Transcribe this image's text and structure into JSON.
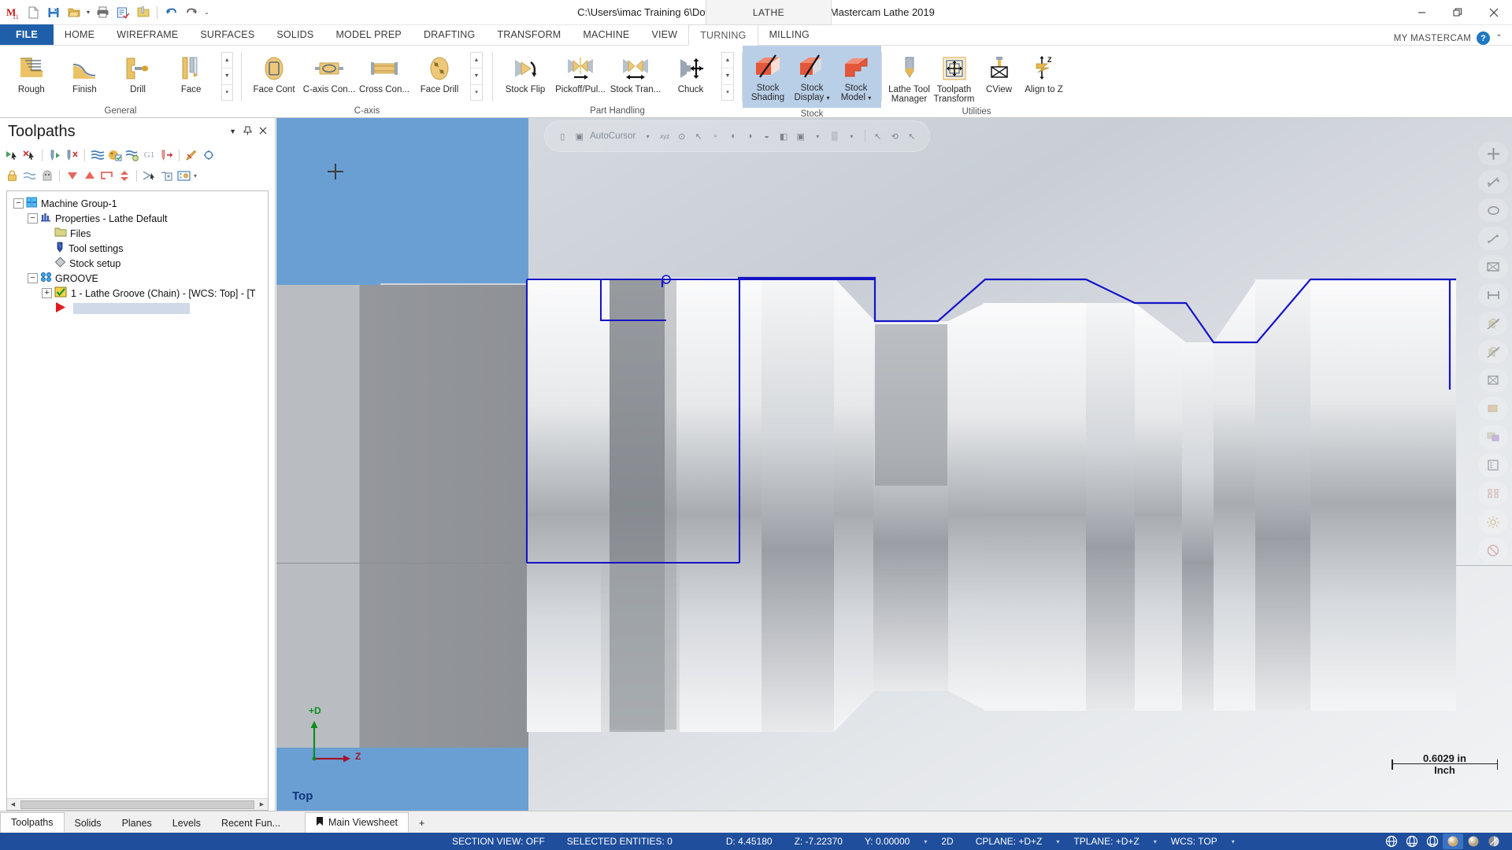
{
  "titlebar": {
    "document_title": "C:\\Users\\imac Training 6\\Downloads\\6812B-21.mcam - Mastercam Lathe 2019",
    "lathe_tab": "LATHE",
    "quick_access": [
      {
        "name": "mastercam-logo-icon",
        "glyph": "M"
      },
      {
        "name": "new-file-icon",
        "glyph": "⬜"
      },
      {
        "name": "save-icon",
        "glyph": "💾"
      },
      {
        "name": "open-file-icon",
        "glyph": "📂"
      },
      {
        "name": "print-icon",
        "glyph": "🖨"
      },
      {
        "name": "save-as-icon",
        "glyph": "📝"
      },
      {
        "name": "zip-file-icon",
        "glyph": "🗂"
      },
      {
        "name": "undo-icon",
        "glyph": "↶"
      },
      {
        "name": "redo-icon",
        "glyph": "↷"
      },
      {
        "name": "customize-qat-icon",
        "glyph": "≡"
      }
    ],
    "window_buttons": [
      {
        "name": "minimize-button",
        "glyph": "—"
      },
      {
        "name": "maximize-button",
        "glyph": "❐"
      },
      {
        "name": "close-button",
        "glyph": "✕"
      }
    ]
  },
  "ribbon": {
    "tabs": [
      {
        "label": "FILE",
        "id": "file",
        "state": "file"
      },
      {
        "label": "HOME",
        "id": "home",
        "state": "normal"
      },
      {
        "label": "WIREFRAME",
        "id": "wireframe",
        "state": "normal"
      },
      {
        "label": "SURFACES",
        "id": "surfaces",
        "state": "normal"
      },
      {
        "label": "SOLIDS",
        "id": "solids",
        "state": "normal"
      },
      {
        "label": "MODEL PREP",
        "id": "model-prep",
        "state": "normal"
      },
      {
        "label": "DRAFTING",
        "id": "drafting",
        "state": "normal"
      },
      {
        "label": "TRANSFORM",
        "id": "transform",
        "state": "normal"
      },
      {
        "label": "MACHINE",
        "id": "machine",
        "state": "normal"
      },
      {
        "label": "VIEW",
        "id": "view",
        "state": "normal"
      },
      {
        "label": "TURNING",
        "id": "turning",
        "state": "active"
      },
      {
        "label": "MILLING",
        "id": "milling",
        "state": "normal"
      }
    ],
    "my_mastercam": "MY MASTERCAM",
    "groups": [
      {
        "name": "General",
        "label": "General",
        "buttons": [
          {
            "label": "Rough",
            "icon": "rough-toolpath-icon"
          },
          {
            "label": "Finish",
            "icon": "finish-toolpath-icon"
          },
          {
            "label": "Drill",
            "icon": "drill-toolpath-icon"
          },
          {
            "label": "Face",
            "icon": "face-toolpath-icon"
          }
        ],
        "has_gallery_scroll": true
      },
      {
        "name": "C-axis",
        "label": "C-axis",
        "buttons": [
          {
            "label": "Face Cont",
            "icon": "face-contour-icon"
          },
          {
            "label": "C-axis Con...",
            "icon": "c-axis-contour-icon"
          },
          {
            "label": "Cross Con...",
            "icon": "cross-contour-icon"
          },
          {
            "label": "Face Drill",
            "icon": "face-drill-icon"
          }
        ],
        "has_gallery_scroll": true
      },
      {
        "name": "Part Handling",
        "label": "Part Handling",
        "buttons": [
          {
            "label": "Stock Flip",
            "icon": "stock-flip-icon"
          },
          {
            "label": "Pickoff/Pul...",
            "icon": "pickoff-pull-icon"
          },
          {
            "label": "Stock Tran...",
            "icon": "stock-transfer-icon"
          },
          {
            "label": "Chuck",
            "icon": "chuck-icon"
          }
        ],
        "has_gallery_scroll": true
      },
      {
        "name": "Stock",
        "label": "Stock",
        "buttons": [
          {
            "label": "Stock Shading",
            "icon": "stock-shading-icon",
            "selected": true
          },
          {
            "label": "Stock Display",
            "icon": "stock-display-icon",
            "selected": true,
            "dropdown": true
          },
          {
            "label": "Stock Model",
            "icon": "stock-model-icon",
            "dropdown": true
          }
        ],
        "has_gallery_scroll": false
      },
      {
        "name": "Utilities",
        "label": "Utilities",
        "buttons": [
          {
            "label": "Lathe Tool Manager",
            "icon": "lathe-tool-manager-icon"
          },
          {
            "label": "Toolpath Transform",
            "icon": "toolpath-transform-icon"
          },
          {
            "label": "CView",
            "icon": "cview-icon"
          },
          {
            "label": "Align to Z",
            "icon": "align-to-z-icon"
          }
        ],
        "has_gallery_scroll": false
      }
    ]
  },
  "toolpaths_panel": {
    "title": "Toolpaths",
    "header_icons": [
      {
        "name": "panel-dropdown-icon",
        "glyph": "▾"
      },
      {
        "name": "panel-pin-icon",
        "glyph": "⚑"
      },
      {
        "name": "panel-close-icon",
        "glyph": "✕"
      }
    ],
    "toolbar_row1": [
      {
        "name": "select-all-toolpaths-icon",
        "glyph": "▶"
      },
      {
        "name": "deselect-all-toolpaths-icon",
        "glyph": "✕"
      },
      {
        "name": "regenerate-selected-icon",
        "glyph": "↑"
      },
      {
        "name": "regenerate-invalid-icon",
        "glyph": "✗"
      },
      {
        "name": "simulate-toolpath-icon",
        "glyph": "≈"
      },
      {
        "name": "verify-toolpath-icon",
        "glyph": "▦"
      },
      {
        "name": "backplot-icon",
        "glyph": "≋"
      },
      {
        "name": "g1-post-icon",
        "glyph": "G1"
      },
      {
        "name": "high-speed-icon",
        "glyph": "↳"
      },
      {
        "name": "edit-toolpath-icon",
        "glyph": "✎"
      }
    ],
    "toolbar_row2": [
      {
        "name": "lock-toolpath-icon",
        "glyph": "🔒"
      },
      {
        "name": "toggle-posting-icon",
        "glyph": "≈"
      },
      {
        "name": "toggle-display-icon",
        "glyph": "●"
      },
      {
        "name": "move-down-icon",
        "glyph": "▼"
      },
      {
        "name": "move-up-icon",
        "glyph": "▲"
      },
      {
        "name": "new-group-icon",
        "glyph": "⌐"
      },
      {
        "name": "expand-collapse-icon",
        "glyph": "↕"
      },
      {
        "name": "toolpath-filter-icon",
        "glyph": "✂"
      },
      {
        "name": "copy-toolpath-icon",
        "glyph": "❐"
      },
      {
        "name": "toolpath-options-icon",
        "glyph": "☷"
      },
      {
        "name": "options-dropdown-icon",
        "glyph": "▾"
      }
    ],
    "tree": [
      {
        "indent": 0,
        "expander": "-",
        "icon": "machine-group-icon",
        "label": "Machine Group-1",
        "selected": false
      },
      {
        "indent": 1,
        "expander": "-",
        "icon": "properties-icon",
        "label": "Properties - Lathe Default",
        "selected": false
      },
      {
        "indent": 2,
        "expander": "",
        "icon": "files-folder-icon",
        "label": "Files",
        "selected": false
      },
      {
        "indent": 2,
        "expander": "",
        "icon": "tool-settings-icon",
        "label": "Tool settings",
        "selected": false
      },
      {
        "indent": 2,
        "expander": "",
        "icon": "stock-setup-icon",
        "label": "Stock setup",
        "selected": false
      },
      {
        "indent": 1,
        "expander": "-",
        "icon": "toolpath-group-icon",
        "label": "GROOVE",
        "selected": false
      },
      {
        "indent": 2,
        "expander": "+",
        "icon": "lathe-groove-op-icon",
        "label": "1 - Lathe Groove (Chain) - [WCS: Top] - [T",
        "selected": false
      },
      {
        "indent": 3,
        "expander": "",
        "icon": "insert-arrow-icon",
        "label": "",
        "selected": true
      }
    ]
  },
  "viewport": {
    "autocursor": {
      "label": "AutoCursor",
      "icons": [
        {
          "name": "autocursor-snap-icon",
          "glyph": "▣"
        },
        {
          "name": "autocursor-pointer-icon",
          "glyph": "↖"
        },
        {
          "name": "autocursor-dropdown-icon",
          "glyph": "▾"
        },
        {
          "name": "xyz-coordinate-icon",
          "glyph": "xyz"
        },
        {
          "name": "origin-snap-icon",
          "glyph": "⊙"
        },
        {
          "name": "arrow-select-icon",
          "glyph": "↖"
        },
        {
          "name": "midpoint-snap-icon",
          "glyph": "▫"
        },
        {
          "name": "endpoint-snap-icon",
          "glyph": "◖"
        },
        {
          "name": "center-snap-icon",
          "glyph": "◑"
        },
        {
          "name": "quadrant-snap-icon",
          "glyph": "◒"
        },
        {
          "name": "intersection-snap-icon",
          "glyph": "◧"
        },
        {
          "name": "nearest-snap-icon",
          "glyph": "▣"
        },
        {
          "name": "snap-dropdown-icon",
          "glyph": "▾"
        },
        {
          "name": "grid-snap-icon",
          "glyph": "▒"
        },
        {
          "name": "grid-dropdown-icon",
          "glyph": "▾"
        },
        {
          "name": "undo-selection-icon",
          "glyph": "↶"
        },
        {
          "name": "select-chain-icon",
          "glyph": "↖"
        },
        {
          "name": "rotate-view-icon",
          "glyph": "⟲"
        },
        {
          "name": "pick-entity-icon",
          "glyph": "↖"
        }
      ]
    },
    "gnomon": {
      "d_axis": "+D",
      "z_axis": "Z",
      "d_color": "#0a8f1e",
      "z_color": "#a3142b"
    },
    "view_name": "Top",
    "scale": {
      "value": "0.6029 in",
      "unit": "Inch"
    },
    "right_toolbar": [
      {
        "name": "fit-to-screen-icon",
        "glyph": "✚"
      },
      {
        "name": "zoom-window-icon",
        "glyph": "↗"
      },
      {
        "name": "zoom-circle-icon",
        "glyph": "◯"
      },
      {
        "name": "spline-view-icon",
        "glyph": "∿"
      },
      {
        "name": "isometric-view-icon",
        "glyph": "⬡"
      },
      {
        "name": "dimension-view-icon",
        "glyph": "⇔"
      },
      {
        "name": "wireframe-shade-icon",
        "glyph": "◫"
      },
      {
        "name": "translucent-shade-icon",
        "glyph": "◩"
      },
      {
        "name": "solid-box-icon",
        "glyph": "⬚"
      },
      {
        "name": "stock-visibility-icon",
        "glyph": "■"
      },
      {
        "name": "levels-icon",
        "glyph": "◰"
      },
      {
        "name": "list-view-icon",
        "glyph": "☰"
      },
      {
        "name": "analyze-icon",
        "glyph": "⌗"
      },
      {
        "name": "settings-gear-icon",
        "glyph": "⚙"
      },
      {
        "name": "blank-entity-icon",
        "glyph": "⊘"
      }
    ]
  },
  "bottom_tabs": {
    "panel_tabs": [
      {
        "label": "Toolpaths",
        "active": true
      },
      {
        "label": "Solids",
        "active": false
      },
      {
        "label": "Planes",
        "active": false
      },
      {
        "label": "Levels",
        "active": false
      },
      {
        "label": "Recent Fun...",
        "active": false
      }
    ],
    "viewsheets": [
      {
        "label": "Main Viewsheet",
        "active": true,
        "icon": "bookmark-icon"
      }
    ],
    "add_viewsheet": "+"
  },
  "statusbar": {
    "items": [
      {
        "label": "SECTION VIEW: OFF",
        "name": "section-view-status"
      },
      {
        "label": "SELECTED ENTITIES: 0",
        "name": "selected-entities-status"
      },
      {
        "label": "D:   4.45180",
        "name": "d-coordinate"
      },
      {
        "label": "Z:   -7.22370",
        "name": "z-coordinate"
      },
      {
        "label": "Y:   0.00000",
        "name": "y-coordinate"
      },
      {
        "label": "2D",
        "name": "dimension-mode",
        "caret": true
      },
      {
        "label": "CPLANE: +D+Z",
        "name": "cplane-selector",
        "caret": true
      },
      {
        "label": "TPLANE: +D+Z",
        "name": "tplane-selector",
        "caret": true
      },
      {
        "label": "WCS: TOP",
        "name": "wcs-selector",
        "caret": true
      }
    ],
    "graphics_icons": [
      {
        "name": "wireframe-display-icon",
        "glyph": "⊕",
        "active": false
      },
      {
        "name": "hidden-line-display-icon",
        "glyph": "⊖",
        "active": false
      },
      {
        "name": "shaded-wireframe-icon",
        "glyph": "⊗",
        "active": false
      },
      {
        "name": "gouraud-shaded-icon",
        "glyph": "◕",
        "active": true
      },
      {
        "name": "flat-shaded-icon",
        "glyph": "●",
        "active": false
      },
      {
        "name": "material-shaded-icon",
        "glyph": "◐",
        "active": false
      }
    ]
  },
  "colors": {
    "accent_blue": "#1f4e9c",
    "stock_blue": "#6a9fd4",
    "chain_blue": "#1414c8",
    "ribbon_select": "#b9cfe8",
    "file_tab": "#1f5fa9"
  }
}
